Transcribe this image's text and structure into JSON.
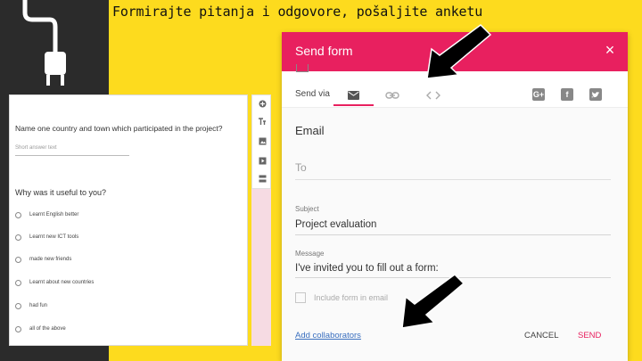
{
  "slide": {
    "title": "Formirajte pitanja i odgovore, pošaljite anketu"
  },
  "form": {
    "question1": "Name one country and town which participated in the project?",
    "short_answer_placeholder": "Short answer text",
    "question2": "Why was it useful to you?",
    "options": [
      "Learnt English better",
      "Learnt new ICT tools",
      "made new friends",
      "Learnt about new countries",
      "had fun",
      "all of the above"
    ]
  },
  "dialog": {
    "title": "Send form",
    "close_symbol": "×",
    "send_via_label": "Send via",
    "email_heading": "Email",
    "to_label": "To",
    "subject_label": "Subject",
    "subject_value": "Project evaluation",
    "message_label": "Message",
    "message_value": "I've invited you to fill out a form:",
    "include_form_label": "Include form in email",
    "add_collaborators": "Add collaborators",
    "cancel": "CANCEL",
    "send": "SEND"
  },
  "colors": {
    "accent": "#e8205f",
    "slide_background": "#fddb1e",
    "left_band": "#2b2b2b",
    "link": "#3a6fbf"
  }
}
